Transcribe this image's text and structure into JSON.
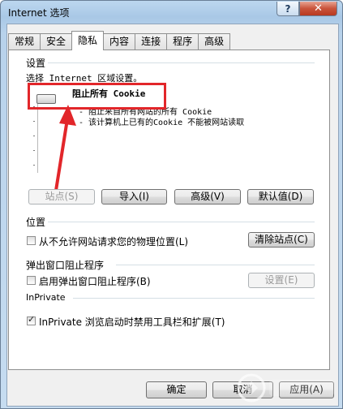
{
  "window": {
    "title": "Internet 选项",
    "help_glyph": "?",
    "close_glyph": "✕"
  },
  "tabs": [
    {
      "label": "常规",
      "active": false
    },
    {
      "label": "安全",
      "active": false
    },
    {
      "label": "隐私",
      "active": true
    },
    {
      "label": "内容",
      "active": false
    },
    {
      "label": "连接",
      "active": false
    },
    {
      "label": "程序",
      "active": false
    },
    {
      "label": "高级",
      "active": false
    }
  ],
  "settings": {
    "heading": "设置",
    "zone_label": "选择 Internet 区域设置。",
    "level_title": "阻止所有 Cookie",
    "level_desc_1": "- 阻止来自所有网站的所有 Cookie",
    "level_desc_2": "- 该计算机上已有的Cookie 不能被网站读取",
    "buttons": {
      "sites": "站点(S)",
      "import": "导入(I)",
      "advanced": "高级(V)",
      "default": "默认值(D)"
    }
  },
  "location": {
    "heading": "位置",
    "never_allow_label": "从不允许网站请求您的物理位置(L)",
    "clear_sites": "清除站点(C)"
  },
  "popup": {
    "heading": "弹出窗口阻止程序",
    "enable_label": "启用弹出窗口阻止程序(B)",
    "settings": "设置(E)"
  },
  "inprivate": {
    "heading": "InPrivate",
    "disable_label": "InPrivate 浏览启动时禁用工具栏和扩展(T)"
  },
  "footer": {
    "ok": "确定",
    "cancel": "取消",
    "apply": "应用(A)"
  },
  "colors": {
    "highlight": "#e2262a",
    "arrow": "#e2262a"
  },
  "slider": {
    "level_fraction": 1.0
  }
}
